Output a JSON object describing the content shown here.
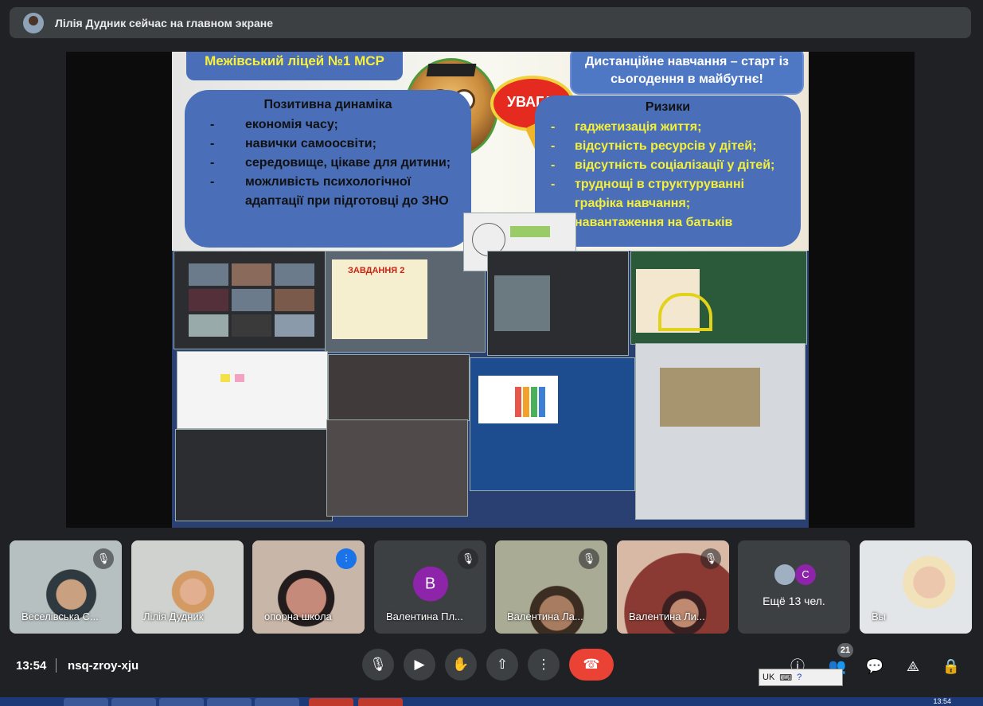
{
  "banner": {
    "text": "Лілія Дудник сейчас на главном экране"
  },
  "slide": {
    "title": "Межівський ліцей №1 МСР",
    "distance": "Дистанційне навчання – старт із сьогодення в майбутнє!",
    "uvaga": "УВАГА!",
    "positive": {
      "title": "Позитивна динаміка",
      "items": [
        "економія часу;",
        "навички самоосвіти;",
        "середовище, цікаве для дитини;",
        "можливість психологічної адаптації при підготовці до ЗНО"
      ]
    },
    "risks": {
      "title": "Ризики",
      "items": [
        "гаджетизація життя;",
        "відсутність ресурсів у дітей;",
        "відсутність соціалізації у дітей;",
        "труднощі в структуруванні графіка навчання;",
        "навантаження на батьків"
      ]
    },
    "zavdannya": "ЗАВДАННЯ 2"
  },
  "participants": [
    {
      "name": "Веселівська С...",
      "muted": true
    },
    {
      "name": "Лілія Дудник",
      "muted": false
    },
    {
      "name": "опорна школа",
      "muted": false,
      "speaking": true
    },
    {
      "name": "Валентина Пл...",
      "muted": true,
      "initial": "B"
    },
    {
      "name": "Валентина Ла...",
      "muted": true
    },
    {
      "name": "Валентина Ли...",
      "muted": true
    },
    {
      "name": "Ещё 13 чел.",
      "initial": "C"
    },
    {
      "name": "Вы"
    }
  ],
  "bottom": {
    "time": "13:54",
    "meeting_code": "nsq-zroy-xju",
    "people_count": "21",
    "lang": "UK"
  },
  "taskbar": {
    "time": "13:54"
  }
}
